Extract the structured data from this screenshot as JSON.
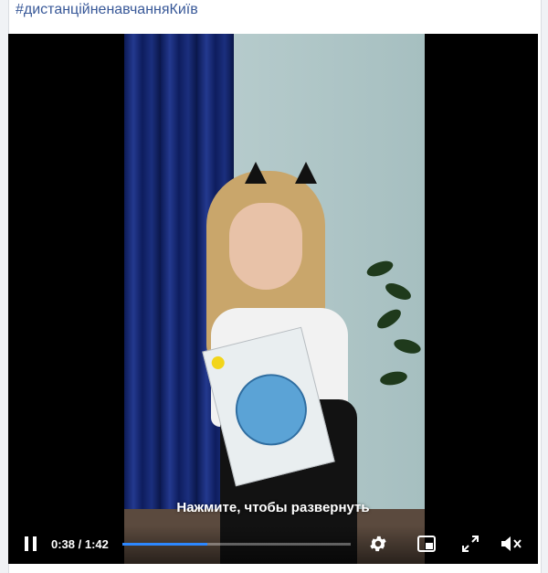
{
  "post": {
    "hashtag": "#дистанційненавчанняКиїв"
  },
  "video": {
    "subtitle": "Нажмите, чтобы развернуть",
    "time_current": "0:38",
    "time_separator": " / ",
    "time_total": "1:42",
    "progress_fraction": 0.372,
    "buffered_fraction": 0.37,
    "accent_color": "#2d88ff"
  },
  "icons": {
    "play_pause": "pause-icon",
    "settings": "gear-icon",
    "pip": "picture-in-picture-icon",
    "fullscreen": "expand-icon",
    "volume": "volume-muted-icon"
  }
}
